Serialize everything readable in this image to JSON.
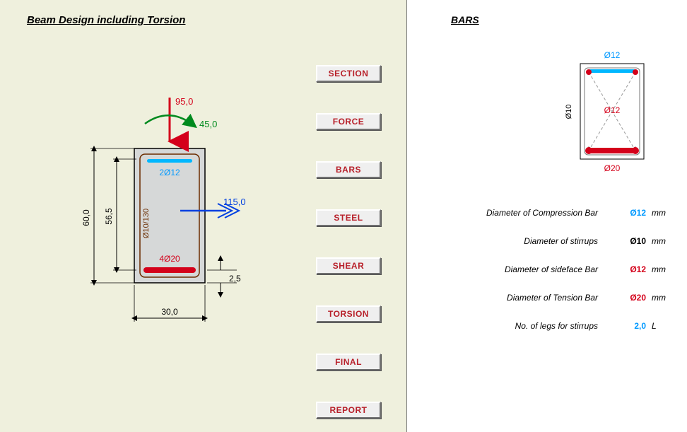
{
  "title_left": "Beam Design including Torsion",
  "title_right": "BARS",
  "buttons": {
    "section": "SECTION",
    "force": "FORCE",
    "bars": "BARS",
    "steel": "STEEL",
    "shear": "SHEAR",
    "torsion": "TORSION",
    "final": "FINAL",
    "report": "REPORT"
  },
  "section": {
    "height": "60,0",
    "inner_height": "56,5",
    "width": "30,0",
    "cover": "2,5",
    "top_bars": "2Ø12",
    "bottom_bars": "4Ø20",
    "stirrup": "Ø10/130",
    "force_axial": "95,0",
    "force_moment": "45,0",
    "force_shear": "115,0"
  },
  "bars_panel": {
    "top": "Ø12",
    "side": "Ø12",
    "bottom": "Ø20",
    "stirrup": "Ø10"
  },
  "params": {
    "row1": {
      "label": "Diameter of Compression Bar",
      "value": "Ø12",
      "unit": "mm",
      "cls": "c-blue"
    },
    "row2": {
      "label": "Diameter of stirrups",
      "value": "Ø10",
      "unit": "mm",
      "cls": ""
    },
    "row3": {
      "label": "Diameter of sideface Bar",
      "value": "Ø12",
      "unit": "mm",
      "cls": "c-red"
    },
    "row4": {
      "label": "Diameter of Tension Bar",
      "value": "Ø20",
      "unit": "mm",
      "cls": "c-red"
    },
    "row5": {
      "label": "No. of legs for stirrups",
      "value": "2,0",
      "unit": "L",
      "cls": "c-blue"
    }
  }
}
